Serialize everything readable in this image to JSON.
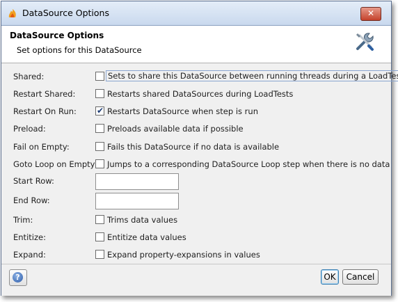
{
  "window": {
    "title": "DataSource Options",
    "close_glyph": "✕"
  },
  "header": {
    "title": "DataSource Options",
    "description": "Set options for this DataSource",
    "icon": "tools-icon"
  },
  "options": {
    "shared": {
      "label": "Shared:",
      "text": "Sets to share this DataSource between running threads during a LoadTest",
      "checked": false
    },
    "restart_shared": {
      "label": "Restart Shared:",
      "text": "Restarts shared DataSources during LoadTests",
      "checked": false
    },
    "restart_on_run": {
      "label": "Restart On Run:",
      "text": "Restarts DataSource when step is run",
      "checked": true
    },
    "preload": {
      "label": "Preload:",
      "text": "Preloads available data if possible",
      "checked": false
    },
    "fail_on_empty": {
      "label": "Fail on Empty:",
      "text": "Fails this DataSource if no data is available",
      "checked": false
    },
    "goto_loop": {
      "label": "Goto Loop on Empty:",
      "text": "Jumps to a corresponding DataSource Loop step when there is no data",
      "checked": false
    },
    "start_row": {
      "label": "Start Row:",
      "value": ""
    },
    "end_row": {
      "label": "End Row:",
      "value": ""
    },
    "trim": {
      "label": "Trim:",
      "text": "Trims data values",
      "checked": false
    },
    "entitize": {
      "label": "Entitize:",
      "text": "Entitize data values",
      "checked": false
    },
    "expand": {
      "label": "Expand:",
      "text": "Expand property-expansions in values",
      "checked": false
    }
  },
  "footer": {
    "help_glyph": "?",
    "ok_label": "OK",
    "cancel_label": "Cancel"
  },
  "check_glyph": "✔"
}
